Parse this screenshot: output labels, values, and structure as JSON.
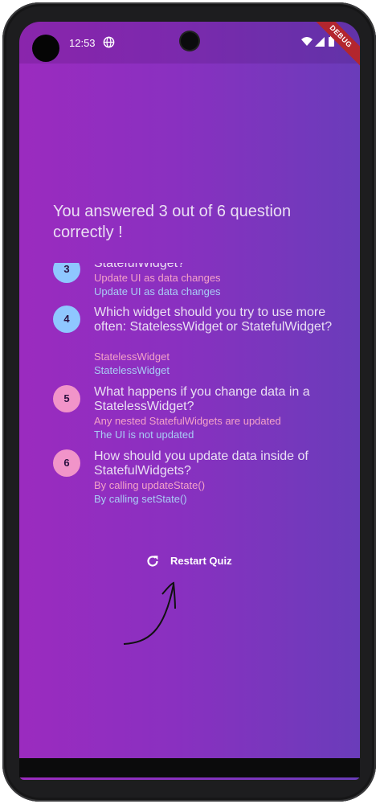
{
  "status_bar": {
    "time": "12:53",
    "debug_label": "DEBUG"
  },
  "summary": {
    "title": "You answered 3 out of 6 question correctly !"
  },
  "partial_item": {
    "question_fragment": "StatefulWidget?"
  },
  "items": [
    {
      "index": "3",
      "correct": true,
      "question": "StatefulWidget?",
      "user_answer": "Update UI as data changes",
      "correct_answer": "Update UI as data changes"
    },
    {
      "index": "4",
      "correct": true,
      "question": "Which widget should you try to use more often: StatelessWidget or StatefulWidget?",
      "user_answer": "StatelessWidget",
      "correct_answer": "StatelessWidget"
    },
    {
      "index": "5",
      "correct": false,
      "question": "What happens if you change data in a StatelessWidget?",
      "user_answer": "Any nested StatefulWidgets are updated",
      "correct_answer": "The UI is not updated"
    },
    {
      "index": "6",
      "correct": false,
      "question": "How should you update data inside of StatefulWidgets?",
      "user_answer": "By calling updateState()",
      "correct_answer": "By calling setState()"
    }
  ],
  "restart_button": {
    "label": "Restart Quiz"
  },
  "colors": {
    "gradient_start": "#9b2bbf",
    "gradient_end": "#6a3cba",
    "correct_badge": "#8fc7ff",
    "wrong_badge": "#f194c9"
  },
  "icons": [
    "globe-icon",
    "wifi-icon",
    "signal-icon",
    "battery-icon",
    "restart-icon",
    "drawn-arrow"
  ]
}
